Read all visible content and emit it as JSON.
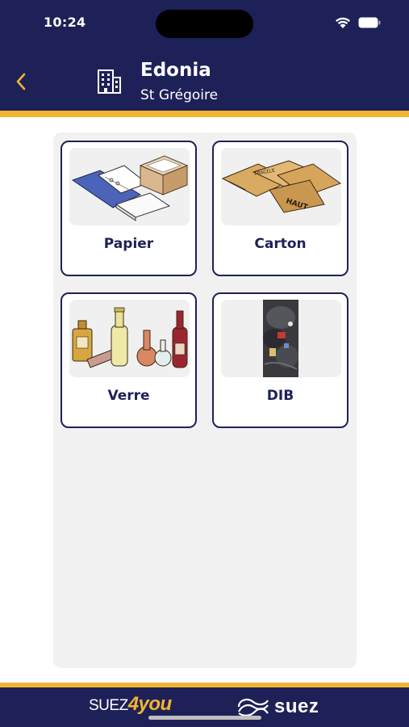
{
  "status_bar": {
    "time": "10:24",
    "icons": [
      "wifi-icon",
      "battery-icon"
    ]
  },
  "header": {
    "back_icon": "chevron-left-icon",
    "site_icon": "building-icon",
    "title": "Edonia",
    "subtitle": "St Grégoire"
  },
  "waste_types": [
    {
      "label": "Papier",
      "image": "paper-binders-image"
    },
    {
      "label": "Carton",
      "image": "cardboard-boxes-image"
    },
    {
      "label": "Verre",
      "image": "glass-bottles-image"
    },
    {
      "label": "DIB",
      "image": "garbage-bag-image"
    }
  ],
  "footer": {
    "logo_left": "SUEZ4you",
    "logo_right": "suez"
  },
  "colors": {
    "navy": "#1e2157",
    "accent_yellow": "#f2b531",
    "panel_bg": "#f1f1f1"
  }
}
